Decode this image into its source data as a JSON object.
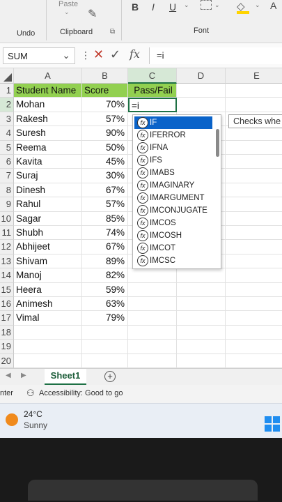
{
  "ribbon": {
    "paste_label": "Paste",
    "undo_label": "Undo",
    "clipboard_label": "Clipboard",
    "font_label": "Font",
    "bold": "B",
    "italic": "I",
    "underline": "U",
    "font_color": "A"
  },
  "formula_bar": {
    "name_box": "SUM",
    "formula": "=i"
  },
  "columns": [
    "A",
    "B",
    "C",
    "D",
    "E"
  ],
  "rows": [
    "1",
    "2",
    "3",
    "4",
    "5",
    "6",
    "7",
    "8",
    "9",
    "10",
    "11",
    "12",
    "13",
    "14",
    "15",
    "16",
    "17",
    "18",
    "19",
    "20"
  ],
  "table": {
    "headers": [
      "Student Name",
      "Score",
      "Pass/Fail"
    ],
    "data": [
      [
        "Mohan",
        "70%"
      ],
      [
        "Rakesh",
        "57%"
      ],
      [
        "Suresh",
        "90%"
      ],
      [
        "Reema",
        "50%"
      ],
      [
        "Kavita",
        "45%"
      ],
      [
        "Suraj",
        "30%"
      ],
      [
        "Dinesh",
        "67%"
      ],
      [
        "Rahul",
        "57%"
      ],
      [
        "Sagar",
        "85%"
      ],
      [
        "Shubh",
        "74%"
      ],
      [
        "Abhijeet",
        "67%"
      ],
      [
        "Shivam",
        "89%"
      ],
      [
        "Manoj",
        "82%"
      ],
      [
        "Heera",
        "59%"
      ],
      [
        "Animesh",
        "63%"
      ],
      [
        "Vimal",
        "79%"
      ]
    ],
    "active_cell_value": "=i"
  },
  "autocomplete": {
    "items": [
      "IF",
      "IFERROR",
      "IFNA",
      "IFS",
      "IMABS",
      "IMAGINARY",
      "IMARGUMENT",
      "IMCONJUGATE",
      "IMCOS",
      "IMCOSH",
      "IMCOT",
      "IMCSC"
    ],
    "selected_index": 0,
    "tooltip": "Checks whe"
  },
  "sheets": {
    "active": "Sheet1",
    "add_label": "+"
  },
  "status": {
    "left_text": "nter",
    "accessibility": "Accessibility: Good to go"
  },
  "taskbar": {
    "temperature": "24°C",
    "weather": "Sunny"
  },
  "colors": {
    "header_fill": "#92d050",
    "accent": "#1e7145",
    "selection": "#0a63c9"
  }
}
